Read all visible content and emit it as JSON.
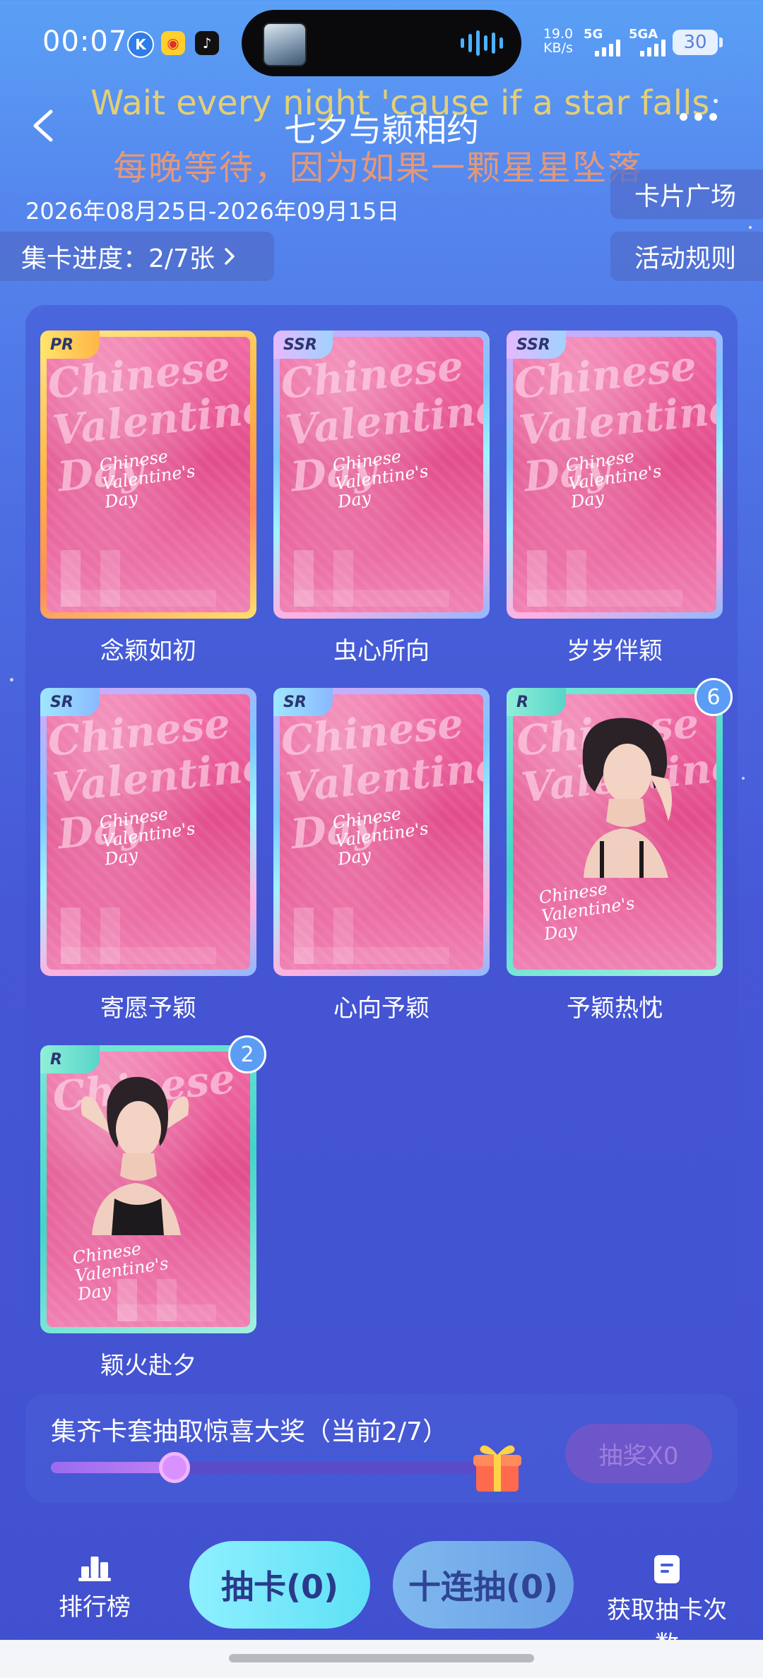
{
  "status_bar": {
    "time": "00:07",
    "net_speed_value": "19.0",
    "net_speed_unit": "KB/s",
    "signal_1": "5G",
    "signal_2": "5GA",
    "battery": "30"
  },
  "header": {
    "title": "七夕与颖相约",
    "lyric_en": "Wait every night 'cause if a star falls",
    "lyric_cn": "每晚等待，因为如果一颗星星坠落",
    "date_range": "2026年08月25日-2026年09月15日",
    "card_square_label": "卡片广场",
    "rules_label": "活动规则",
    "progress_label": "集卡进度：2/7张"
  },
  "cards": [
    {
      "name": "念颖如初",
      "rarity": "PR",
      "count": "",
      "owned": false
    },
    {
      "name": "虫心所向",
      "rarity": "SSR",
      "count": "",
      "owned": false
    },
    {
      "name": "岁岁伴颖",
      "rarity": "SSR",
      "count": "",
      "owned": false
    },
    {
      "name": "寄愿予颖",
      "rarity": "SR",
      "count": "",
      "owned": false
    },
    {
      "name": "心向予颖",
      "rarity": "SR",
      "count": "",
      "owned": false
    },
    {
      "name": "予颖热忱",
      "rarity": "R",
      "count": "6",
      "owned": true
    },
    {
      "name": "颖火赴夕",
      "rarity": "R",
      "count": "2",
      "owned": true
    }
  ],
  "reward": {
    "text": "集齐卡套抽取惊喜大奖（当前2/7）",
    "progress_fraction": 0.286,
    "draw_label": "抽奖X0"
  },
  "bottom_nav": {
    "leaderboard": "排行榜",
    "draw_one": "抽卡(0)",
    "draw_ten": "十连抽(0)",
    "get_chances": "获取抽卡次数"
  },
  "colors": {
    "accent_cyan": "#5ee0f5",
    "badge_blue": "#5b9df5",
    "lyric_en": "#f2d56a",
    "lyric_cn": "#f49a6c"
  }
}
